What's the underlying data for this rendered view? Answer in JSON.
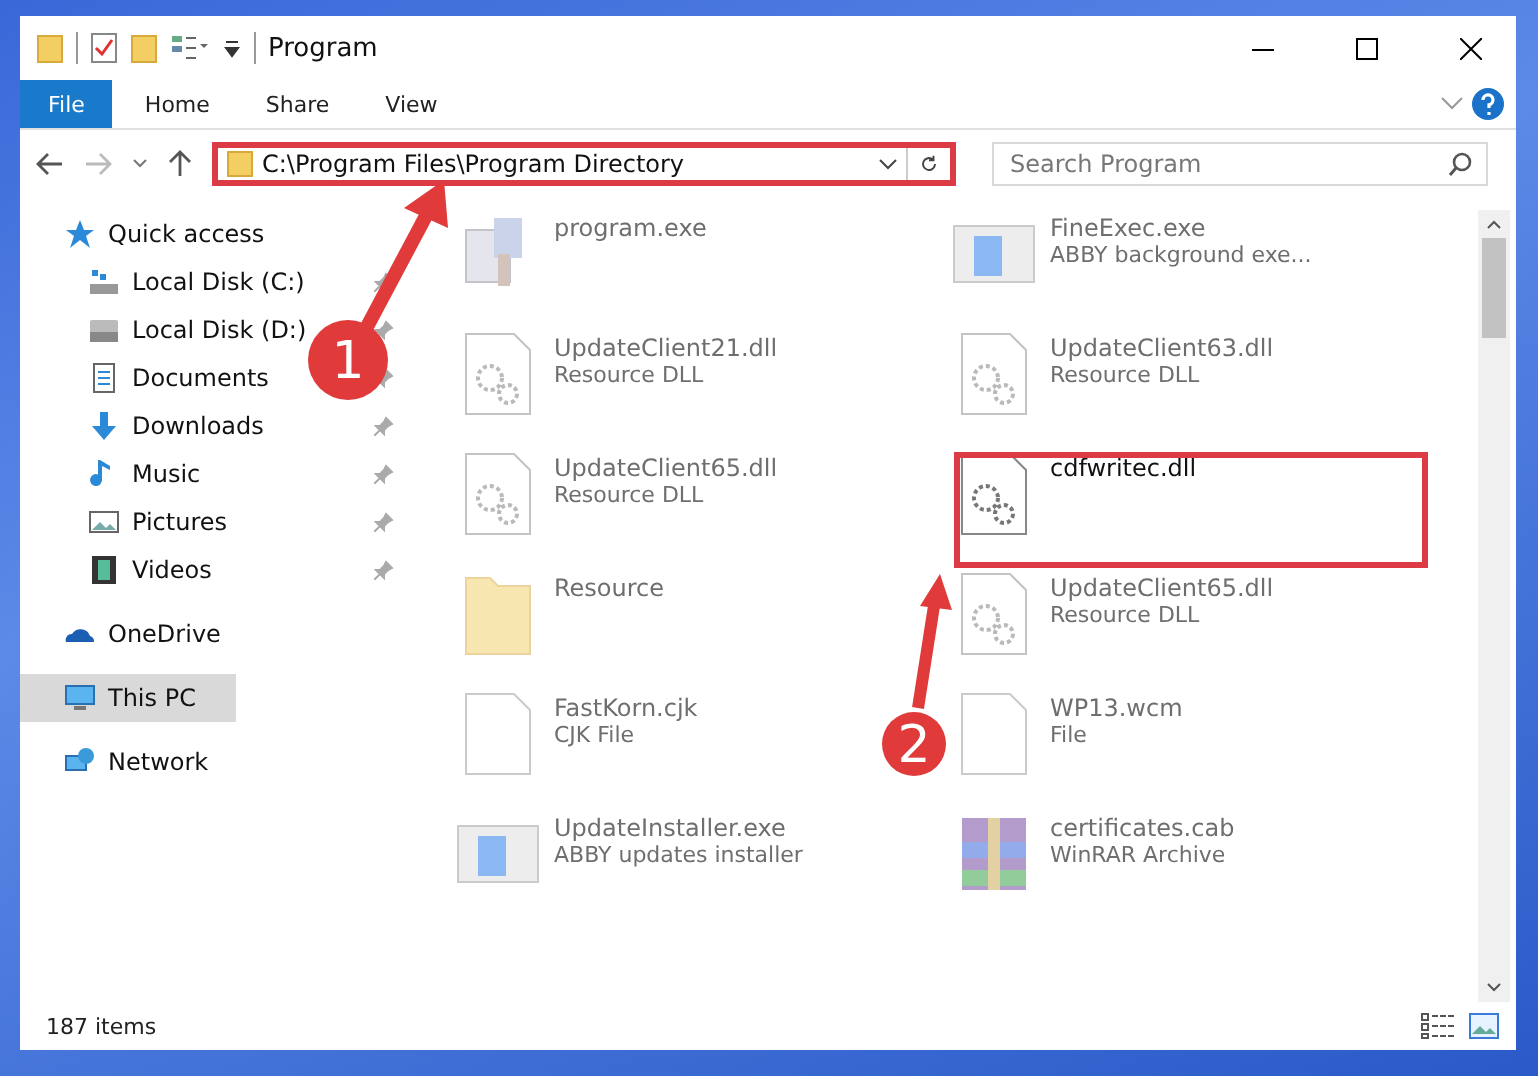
{
  "window": {
    "title": "Program"
  },
  "ribbon_tabs": [
    {
      "label": "File",
      "selected": true
    },
    {
      "label": "Home",
      "selected": false
    },
    {
      "label": "Share",
      "selected": false
    },
    {
      "label": "View",
      "selected": false
    }
  ],
  "address_bar": {
    "path": "C:\\Program Files\\Program Directory"
  },
  "search": {
    "placeholder": "Search Program"
  },
  "sidebar": {
    "items": [
      {
        "label": "Quick access",
        "selected": false,
        "children": [
          {
            "label": "Local Disk (C:)",
            "pinned": true
          },
          {
            "label": "Local Disk (D:)",
            "pinned": true
          },
          {
            "label": "Documents",
            "pinned": true
          },
          {
            "label": "Downloads",
            "pinned": true
          },
          {
            "label": "Music",
            "pinned": true
          },
          {
            "label": "Pictures",
            "pinned": true
          },
          {
            "label": "Videos",
            "pinned": true
          }
        ]
      },
      {
        "label": "OneDrive",
        "selected": false
      },
      {
        "label": "This PC",
        "selected": true
      },
      {
        "label": "Network",
        "selected": false
      }
    ]
  },
  "files": [
    {
      "name": "program.exe",
      "kind": "app",
      "dimmed": true
    },
    {
      "name": "FineExec.exe",
      "type": "ABBY background exe...",
      "kind": "window",
      "dimmed": true
    },
    {
      "name": "UpdateClient21.dll",
      "type": "Resource DLL",
      "kind": "dll",
      "dimmed": true
    },
    {
      "name": "UpdateClient63.dll",
      "type": "Resource DLL",
      "kind": "dll",
      "dimmed": true
    },
    {
      "name": "UpdateClient65.dll",
      "type": "Resource DLL",
      "kind": "dll",
      "dimmed": true
    },
    {
      "name": "cdfwritec.dll",
      "kind": "dll",
      "dimmed": false
    },
    {
      "name": "Resource",
      "kind": "folder",
      "dimmed": true
    },
    {
      "name": "UpdateClient65.dll",
      "type": "Resource DLL",
      "kind": "dll",
      "dimmed": true
    },
    {
      "name": "FastKorn.cjk",
      "type": "CJK File",
      "kind": "blank",
      "dimmed": true
    },
    {
      "name": "WP13.wcm",
      "type": "File",
      "kind": "blank",
      "dimmed": true
    },
    {
      "name": "UpdateInstaller.exe",
      "type": "ABBY updates installer",
      "kind": "window",
      "dimmed": true
    },
    {
      "name": "certificates.cab",
      "type": "WinRAR Archive",
      "kind": "archive",
      "dimmed": true
    }
  ],
  "status_bar": {
    "count": "187 items"
  },
  "callouts": [
    {
      "number": "1"
    },
    {
      "number": "2"
    }
  ]
}
